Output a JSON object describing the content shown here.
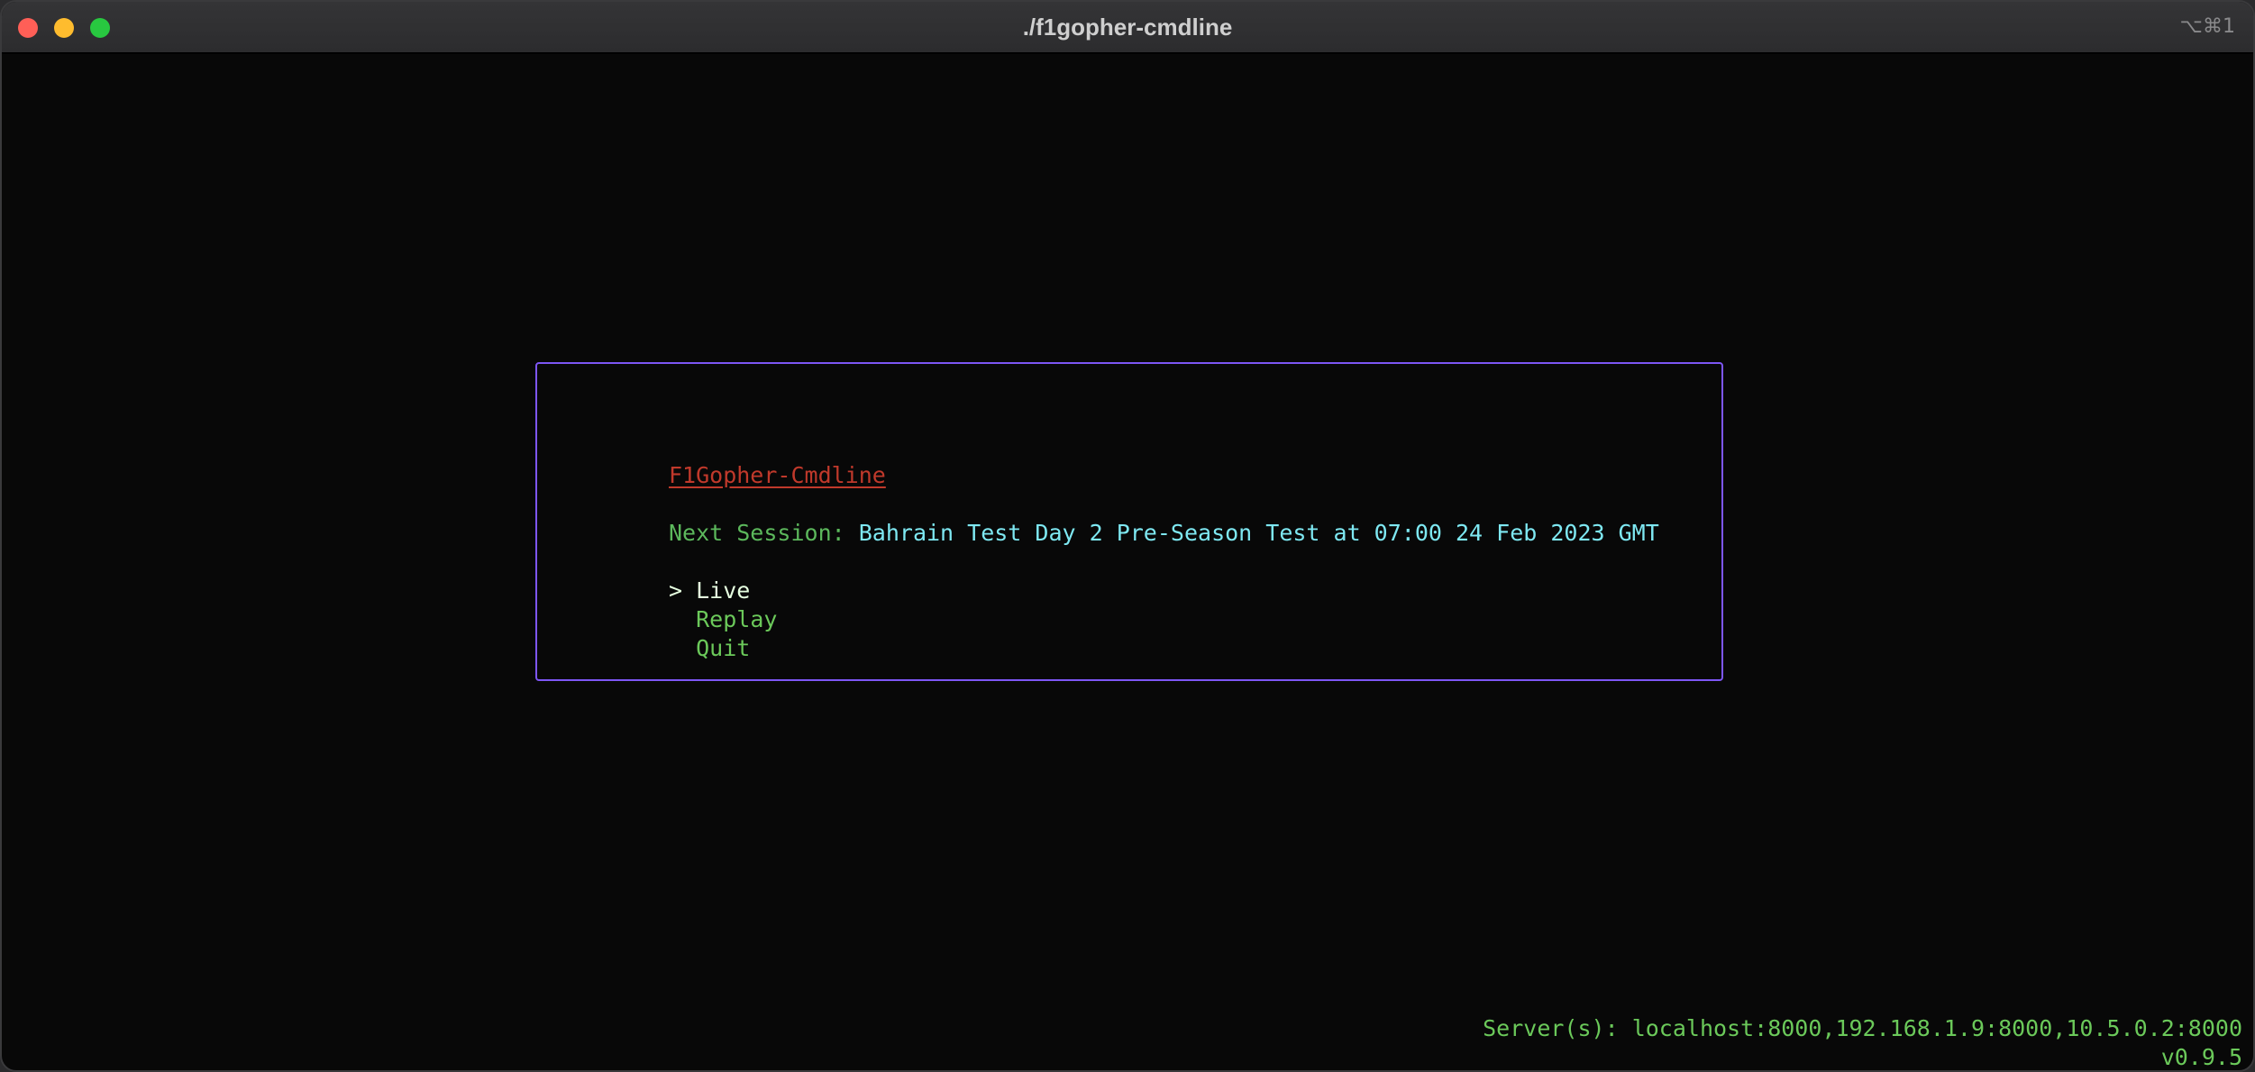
{
  "window": {
    "title": "./f1gopher-cmdline",
    "shortcut": "⌥⌘1"
  },
  "app": {
    "name": "F1Gopher-Cmdline",
    "next_session_label": "Next Session:",
    "next_session_value": "Bahrain Test Day 2 Pre-Season Test at 07:00 24 Feb 2023 GMT"
  },
  "menu": {
    "cursor": ">",
    "items": [
      {
        "label": "Live",
        "selected": true
      },
      {
        "label": "Replay",
        "selected": false
      },
      {
        "label": "Quit",
        "selected": false
      }
    ]
  },
  "footer": {
    "servers": "Server(s): localhost:8000,192.168.1.9:8000,10.5.0.2:8000",
    "version": "v0.9.5"
  },
  "colors": {
    "border_accent": "#7d56f4",
    "title_red": "#c0392b",
    "label_green": "#5cb85c",
    "value_cyan": "#7ee8f2",
    "background": "#080808"
  }
}
